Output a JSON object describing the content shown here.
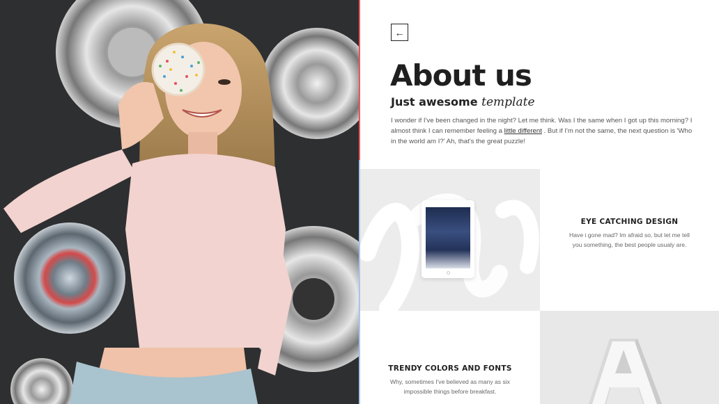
{
  "header": {
    "back_icon": "arrow-left-icon",
    "back_glyph": "←",
    "title": "About us",
    "subtitle_bold": "Just awesome",
    "subtitle_italic": "template",
    "intro_before": "I wonder if I've been changed in the night? Let me think. Was I the same when I got up this morning? I almost think I can remember feeling a ",
    "intro_link": "little different",
    "intro_after": " . But if I'm not the same, the next question is 'Who in the world am I?' Ah, that's the great puzzle!"
  },
  "features": [
    {
      "heading": "EYE CATCHING DESIGN",
      "body": "Have i gone mad? Im afraid so, but let me tell you something, the best people usualy are."
    },
    {
      "heading": "TRENDY COLORS AND FONTS",
      "body": "Why, sometimes I've believed as many as six impossible things before breakfast."
    }
  ],
  "tile_images": {
    "a_letter": "A"
  },
  "colors": {
    "divider_top": "#e8595f",
    "divider_bottom": "#a9c7e6",
    "tile_gray": "#ececec"
  }
}
